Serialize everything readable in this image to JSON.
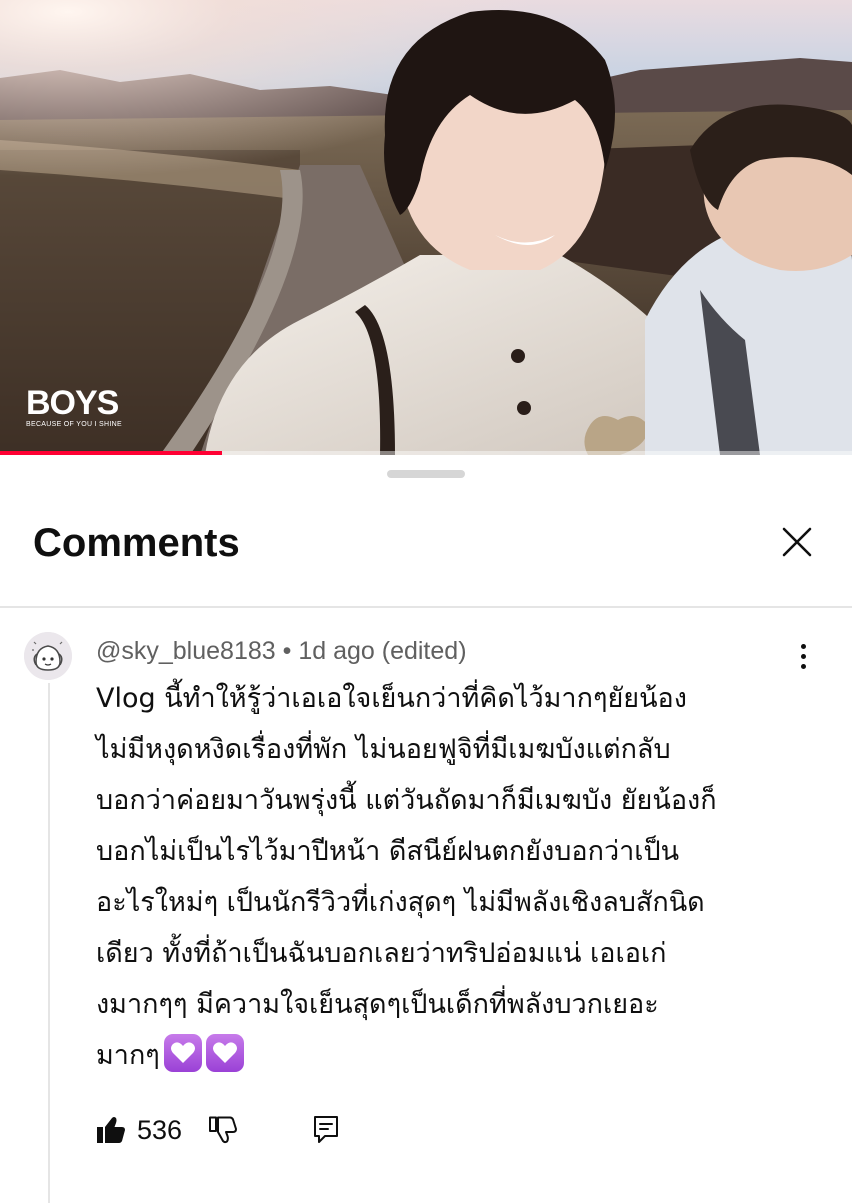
{
  "video": {
    "channel_logo_mark": "BOYS",
    "channel_logo_tagline": "BECAUSE OF YOU I SHINE",
    "progress": 0.26
  },
  "sheet": {
    "title": "Comments"
  },
  "comment": {
    "author": "@sky_blue8183",
    "time": "1d ago",
    "edited": "(edited)",
    "body_lines": [
      "Vlog นี้ทำให้รู้ว่าเอเอใจเย็นกว่าที่คิดไว้มากๆยัยน้อง",
      "ไม่มีหงุดหงิดเรื่องที่พัก ไม่นอยฟูจิที่มีเมฆบังแต่กลับ",
      "บอกว่าค่อยมาวันพรุ่งนี้ แต่วันถัดมาก็มีเมฆบัง ยัยน้องก็",
      "บอกไม่เป็นไรไว้มาปีหน้า ดีสนีย์ฝนตกยังบอกว่าเป็น",
      "อะไรใหม่ๆ เป็นนักรีวิวที่เก่งสุดๆ ไม่มีพลังเชิงลบสักนิด",
      "เดียว ทั้งที่ถ้าเป็นฉันบอกเลยว่าทริปอ่อมแน่ เอเอเก่",
      "งมากๆๆ มีความใจเย็นสุดๆเป็นเด็กที่พลังบวกเยอะ",
      "มากๆ"
    ],
    "emoji": [
      "purple-heart",
      "purple-heart"
    ],
    "likes": "536"
  },
  "icons": {
    "close": "close-icon",
    "more": "more-vertical-icon",
    "like": "thumbs-up-icon",
    "dislike": "thumbs-down-icon",
    "reply": "reply-icon"
  },
  "colors": {
    "progress": "#ff0033",
    "heart_bg": "#a24bdc",
    "meta_text": "#606060"
  }
}
